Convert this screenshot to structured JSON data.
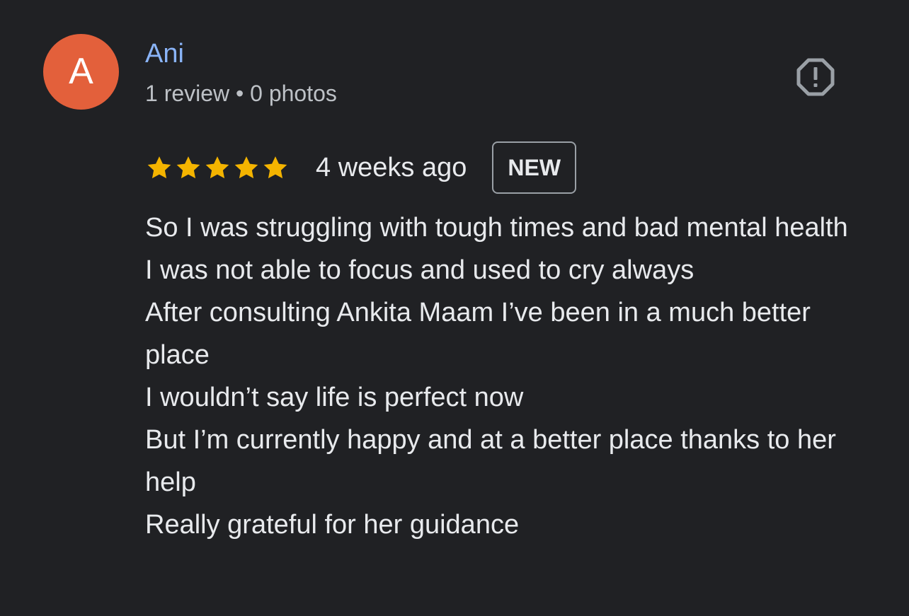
{
  "author": {
    "avatar_letter": "A",
    "avatar_color": "#e3603b",
    "name": "Ani",
    "meta": "1 review • 0 photos"
  },
  "report_icon": "report-octagon-icon",
  "rating": {
    "stars": 5,
    "max_stars": 5,
    "star_color": "#f4b400",
    "time_ago": "4 weeks ago",
    "badge": "NEW"
  },
  "review": {
    "lines": [
      "So I was struggling with tough times and bad mental health",
      "I was not able to focus and used to cry always",
      "After consulting Ankita Maam I’ve been in a much better place",
      "I wouldn’t say life is perfect now",
      "But I’m currently happy and at a better place thanks to her help",
      "Really grateful for her guidance"
    ]
  }
}
